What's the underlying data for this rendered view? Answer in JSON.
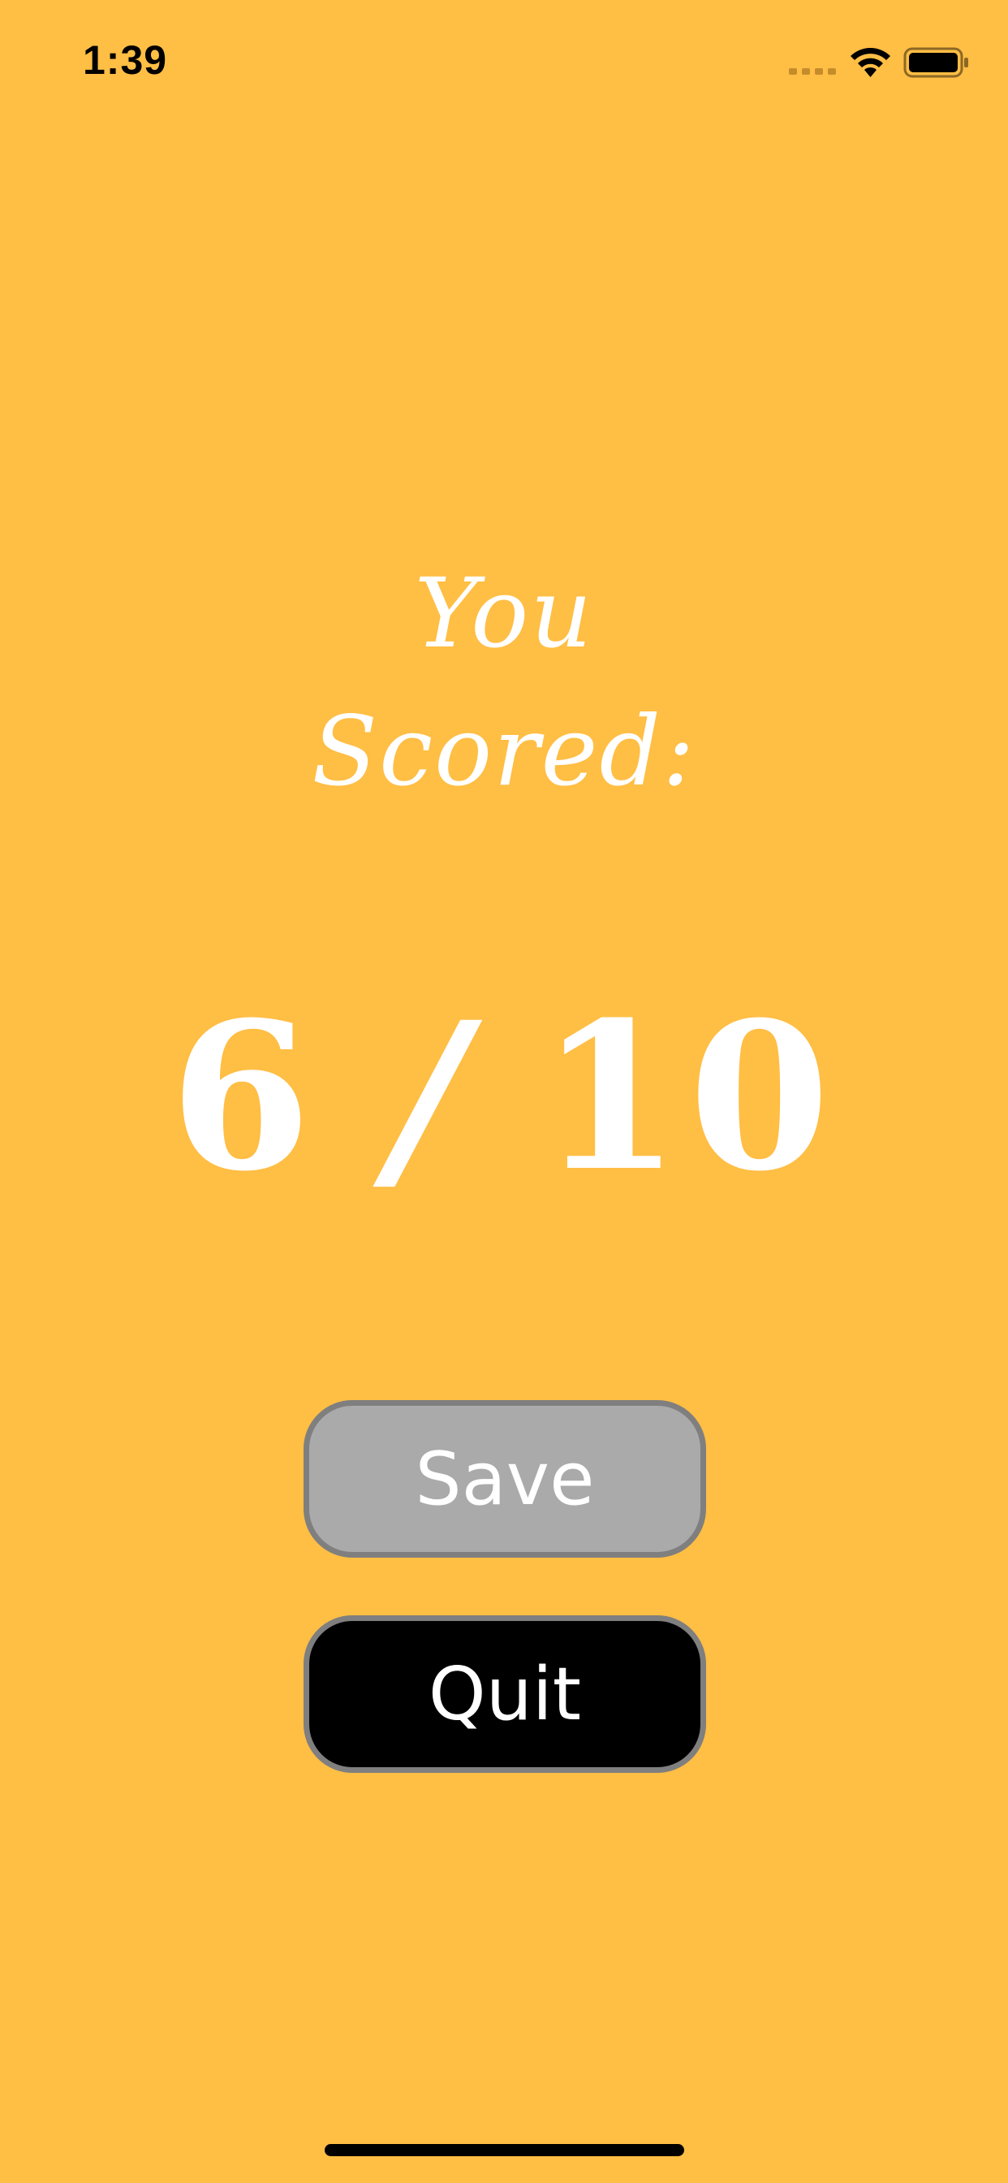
{
  "status_bar": {
    "time": "1:39"
  },
  "heading": {
    "line1": "You",
    "line2": "Scored:"
  },
  "score": {
    "value": "6",
    "separator": "/",
    "total": "10"
  },
  "buttons": {
    "save_label": "Save",
    "quit_label": "Quit"
  },
  "colors": {
    "background": "#FFBE44",
    "text": "#FFFFFF",
    "save_button": "#AAAAAA",
    "quit_button": "#000000",
    "button_border": "#7F7F7F"
  },
  "icons": {
    "signal": "cellular-signal-icon",
    "wifi": "wifi-icon",
    "battery": "battery-icon"
  }
}
